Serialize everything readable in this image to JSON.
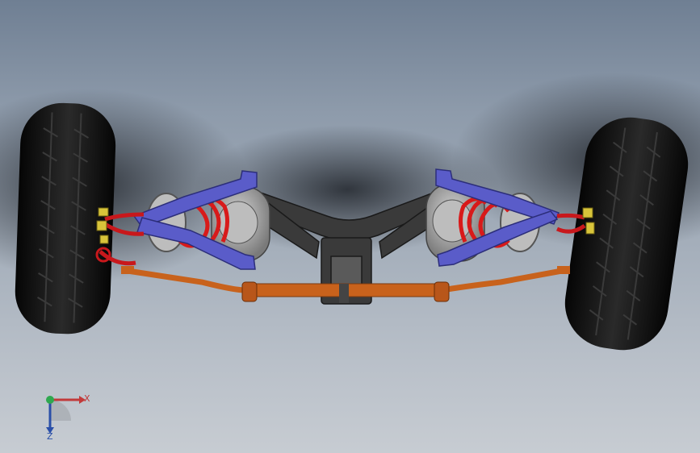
{
  "viewport": {
    "background_top": "#6f7f93",
    "background_bottom": "#c7ccd2"
  },
  "model": {
    "colors": {
      "tire": "#111111",
      "a_arm": "#5a5cc9",
      "spring": "#d81a1a",
      "housing": "#9b9b9b",
      "frame": "#3a3a3a",
      "tie_rod": "#c8621c",
      "bolt": "#d8c43a"
    }
  },
  "triad": {
    "x_label": "X",
    "z_label": "Z",
    "x_color": "#c23a3a",
    "y_color": "#2fa84f",
    "z_color": "#2a4fa8"
  }
}
